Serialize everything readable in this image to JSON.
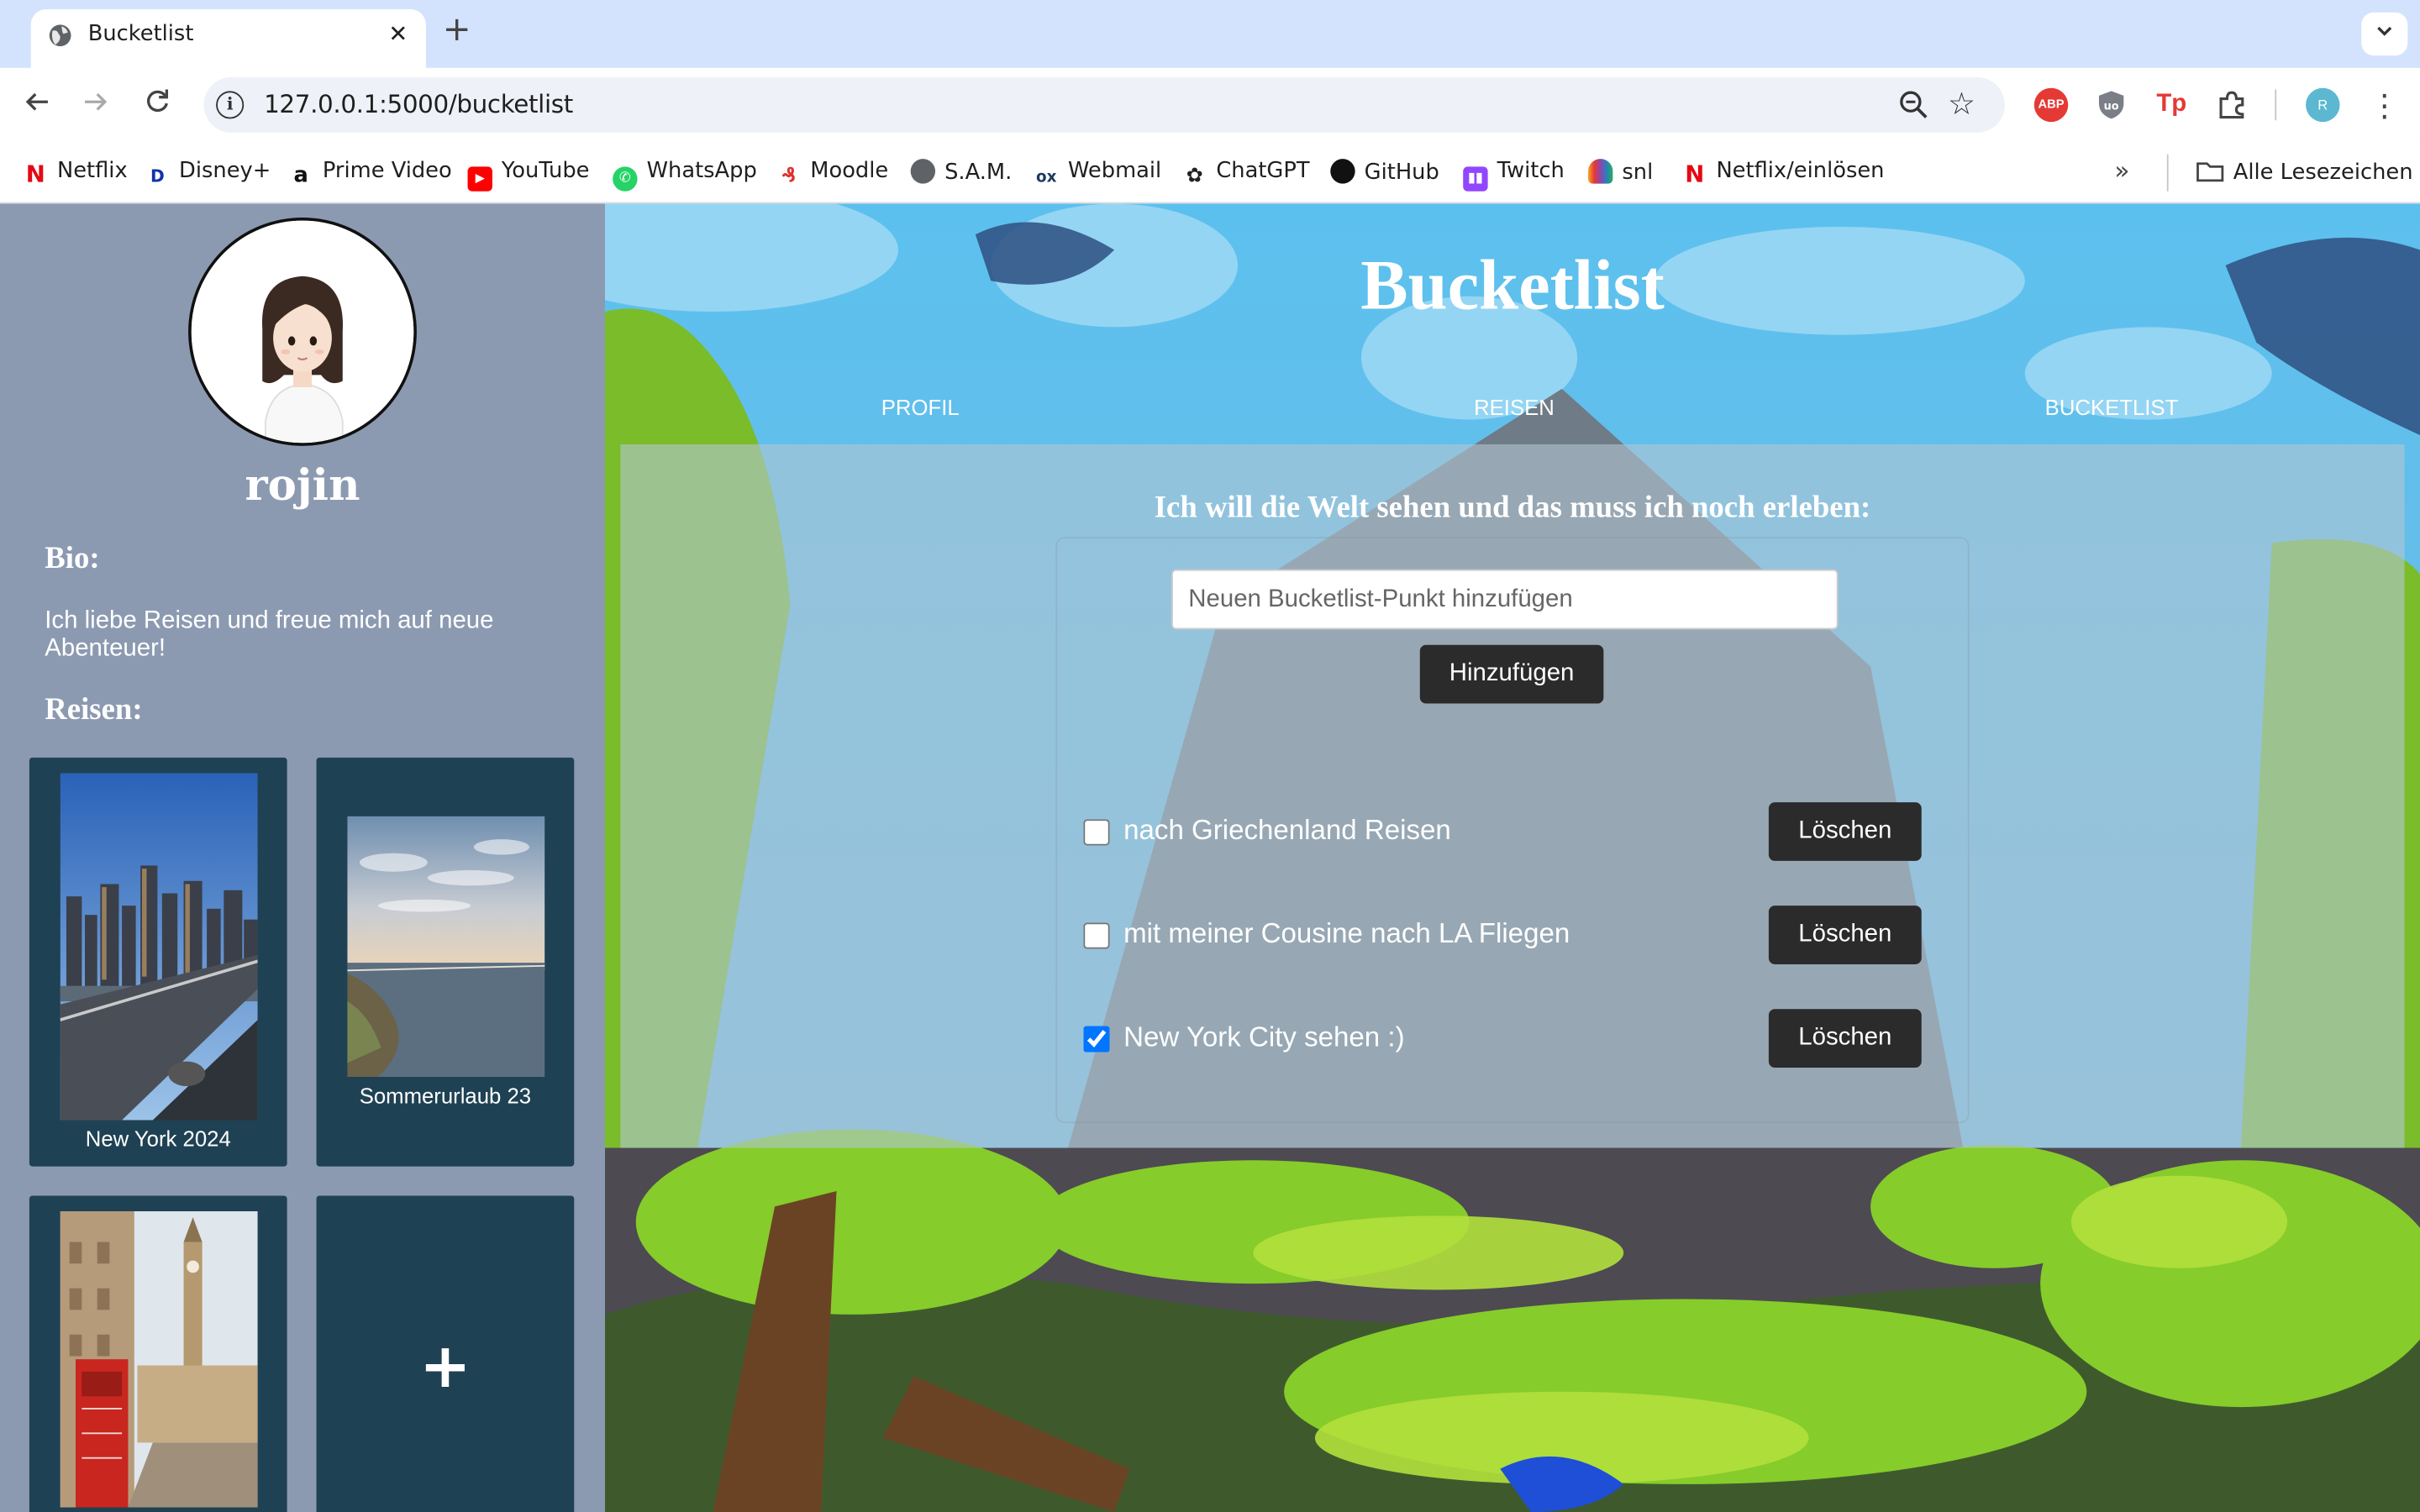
{
  "browser": {
    "tab_title": "Bucketlist",
    "url": "127.0.0.1:5000/bucketlist",
    "bookmarks": [
      "Netflix",
      "Disney+",
      "Prime Video",
      "YouTube",
      "WhatsApp",
      "Moodle",
      "S.A.M.",
      "Webmail",
      "ChatGPT",
      "GitHub",
      "Twitch",
      "snl",
      "Netflix/einlösen"
    ],
    "all_bookmarks": "Alle Lesezeichen",
    "profile_initial": "R",
    "ext_abp": "ABP",
    "ext_tp": "Tp"
  },
  "sidebar": {
    "username": "rojin",
    "bio_heading": "Bio:",
    "bio_text": "Ich liebe Reisen und freue mich auf neue Abenteuer!",
    "trips_heading": "Reisen:",
    "trips": [
      {
        "caption": "New York 2024"
      },
      {
        "caption": "Sommerurlaub 23"
      },
      {
        "caption": ""
      }
    ],
    "add_trip": "+"
  },
  "main": {
    "title": "Bucketlist",
    "nav": [
      "PROFIL",
      "REISEN",
      "BUCKETLIST"
    ],
    "panel_heading": "Ich will die Welt sehen und das muss ich noch erleben:",
    "input_placeholder": "Neuen Bucketlist-Punkt hinzufügen",
    "add_button": "Hinzufügen",
    "items": [
      {
        "label": "nach Griechenland Reisen",
        "done": false,
        "delete": "Löschen"
      },
      {
        "label": "mit meiner Cousine nach LA Fliegen",
        "done": false,
        "delete": "Löschen"
      },
      {
        "label": "New York City sehen :)",
        "done": true,
        "delete": "Löschen"
      }
    ]
  }
}
